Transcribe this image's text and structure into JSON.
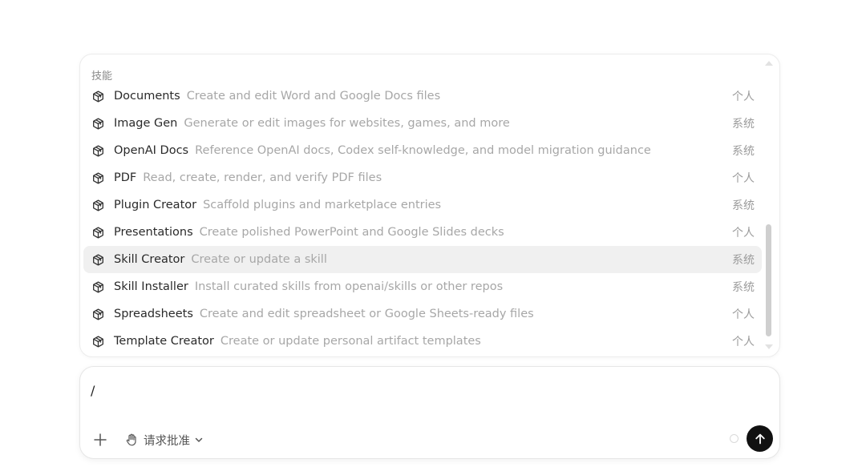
{
  "skills_menu": {
    "heading": "技能",
    "items": [
      {
        "name": "Documents",
        "description": "Create and edit Word and Google Docs files",
        "scope": "个人",
        "selected": false
      },
      {
        "name": "Image Gen",
        "description": "Generate or edit images for websites, games, and more",
        "scope": "系统",
        "selected": false
      },
      {
        "name": "OpenAI Docs",
        "description": "Reference OpenAI docs, Codex self-knowledge, and model migration guidance",
        "scope": "系统",
        "selected": false
      },
      {
        "name": "PDF",
        "description": "Read, create, render, and verify PDF files",
        "scope": "个人",
        "selected": false
      },
      {
        "name": "Plugin Creator",
        "description": "Scaffold plugins and marketplace entries",
        "scope": "系统",
        "selected": false
      },
      {
        "name": "Presentations",
        "description": "Create polished PowerPoint and Google Slides decks",
        "scope": "个人",
        "selected": false
      },
      {
        "name": "Skill Creator",
        "description": "Create or update a skill",
        "scope": "系统",
        "selected": true
      },
      {
        "name": "Skill Installer",
        "description": "Install curated skills from openai/skills or other repos",
        "scope": "系统",
        "selected": false
      },
      {
        "name": "Spreadsheets",
        "description": "Create and edit spreadsheet or Google Sheets-ready files",
        "scope": "个人",
        "selected": false
      },
      {
        "name": "Template Creator",
        "description": "Create or update personal artifact templates",
        "scope": "个人",
        "selected": false
      }
    ],
    "item_icon": "cube-icon"
  },
  "composer": {
    "input_value": "/",
    "add_icon": "plus-icon",
    "approval_icon": "hand-icon",
    "approval_label": "请求批准",
    "approval_chevron": "chevron-down-icon",
    "send_icon": "arrow-up-icon"
  },
  "colors": {
    "selected_row_bg": "#f0f0f0",
    "send_button_bg": "#111111",
    "description_text": "#a7a7a7"
  }
}
